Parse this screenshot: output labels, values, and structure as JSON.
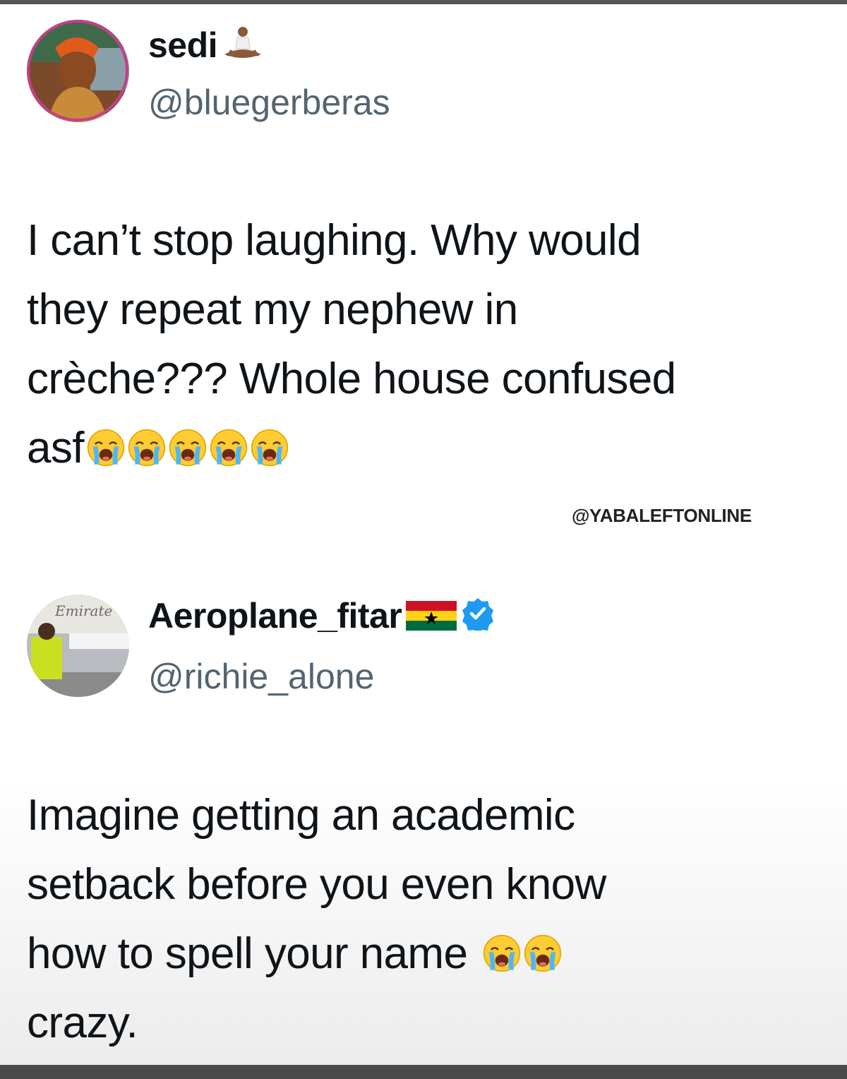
{
  "tweets": [
    {
      "author": {
        "display_name": "sedi",
        "name_emoji": "person-in-lotus-position-emoji",
        "handle": "@bluegerberas",
        "avatar": "profile-photo"
      },
      "text_lines": [
        "I can’t stop laughing. Why would",
        "they repeat my nephew in",
        "crèche??? Whole house confused",
        "asf"
      ],
      "trailing_emoji": "loudly-crying-face-emoji",
      "trailing_emoji_count": 5
    },
    {
      "author": {
        "display_name": "Aeroplane_fitar",
        "name_emoji": "ghana-flag-emoji",
        "verified": true,
        "verified_color": "#1d9bf0",
        "handle": "@richie_alone",
        "avatar": "profile-photo",
        "avatar_text": "Emirate"
      },
      "text_lines": [
        "Imagine getting an academic",
        "setback before you even know",
        "how to spell your name",
        "crazy."
      ],
      "trailing_emoji": "loudly-crying-face-emoji",
      "trailing_emoji_count": 2
    }
  ],
  "watermark": "@YABALEFTONLINE",
  "colors": {
    "text": "#0f1419",
    "handle": "#536471",
    "verified": "#1d9bf0"
  }
}
